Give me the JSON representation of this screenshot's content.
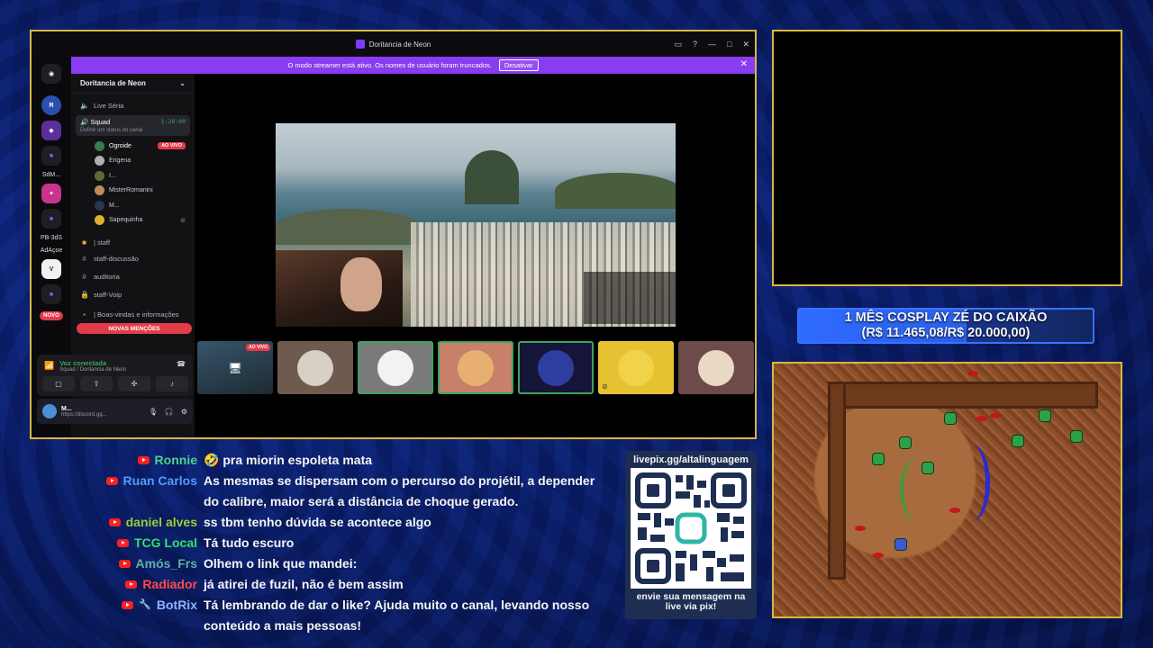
{
  "discord": {
    "window_title": "Doritancia de Neon",
    "streamer_banner": {
      "text": "O modo streamer está ativo. Os nomes de usuário foram truncados.",
      "button": "Desativar"
    },
    "rail": {
      "labels": [
        "SdM...",
        "PB-3dS",
        "AdAçoe"
      ],
      "new_badge": "NOVO"
    },
    "guild_name": "Doritancia de Neon",
    "channels": {
      "live_channel": "Live Séria",
      "voice": {
        "name": "Squad",
        "timer": "1:28:00",
        "status_hint": "Definir um status do canal"
      },
      "members": [
        {
          "name": "Ogroide",
          "badge": "AO VIVO"
        },
        {
          "name": "Erigena"
        },
        {
          "name": "I..."
        },
        {
          "name": "MisterRomanini"
        },
        {
          "name": "M..."
        },
        {
          "name": "Sapequinha"
        }
      ],
      "category": "| staff",
      "text_channels": [
        "staff-discussão",
        "auditoria",
        "staff-Voip"
      ],
      "category_next": "| Boas-vindas e informações",
      "mentions_button": "NOVAS MENÇÕES"
    },
    "voice_panel": {
      "title": "Voz conectada",
      "sub": "Squad / Doritancia de Neon"
    },
    "user_bar": {
      "name": "M...",
      "status": "https://discord.gg..."
    },
    "tile_live_badge": "AO VIVO"
  },
  "goal": {
    "line1": "1 MÊS COSPLAY ZÉ DO CAIXÃO",
    "line2": "(R$ 11.465,08/R$ 20.000,00)",
    "current": 11465.08,
    "target": 20000.0
  },
  "chat": [
    {
      "name": "Ronnie",
      "color": "#4fd18b",
      "emoji": "🤣",
      "text": "pra miorin espoleta mata"
    },
    {
      "name": "Ruan Carlos",
      "color": "#4f9dff",
      "text": "As mesmas se dispersam com o percurso do projétil, a depender do calibre, maior será a distância de choque gerado."
    },
    {
      "name": "daniel alves",
      "color": "#9acd32",
      "text": "ss tbm tenho dúvida se acontece algo"
    },
    {
      "name": "TCG Local",
      "color": "#33e06a",
      "text": "Tá tudo escuro"
    },
    {
      "name": "Amós_Frs",
      "color": "#5fb0a0",
      "text": "Olhem o link que mandei:"
    },
    {
      "name": "Radiador",
      "color": "#ff4a4a",
      "text": "já atirei de fuzil, não é bem assim"
    },
    {
      "name": "BotRix",
      "color": "#8fb4ff",
      "text": "Tá lembrando de dar o like? Ajuda muito o canal, levando nosso conteúdo a mais pessoas!"
    }
  ],
  "qr": {
    "url": "livepix.gg/altalinguagem",
    "caption_line1": "envie sua mensagem na",
    "caption_line2": "live via pix!"
  }
}
